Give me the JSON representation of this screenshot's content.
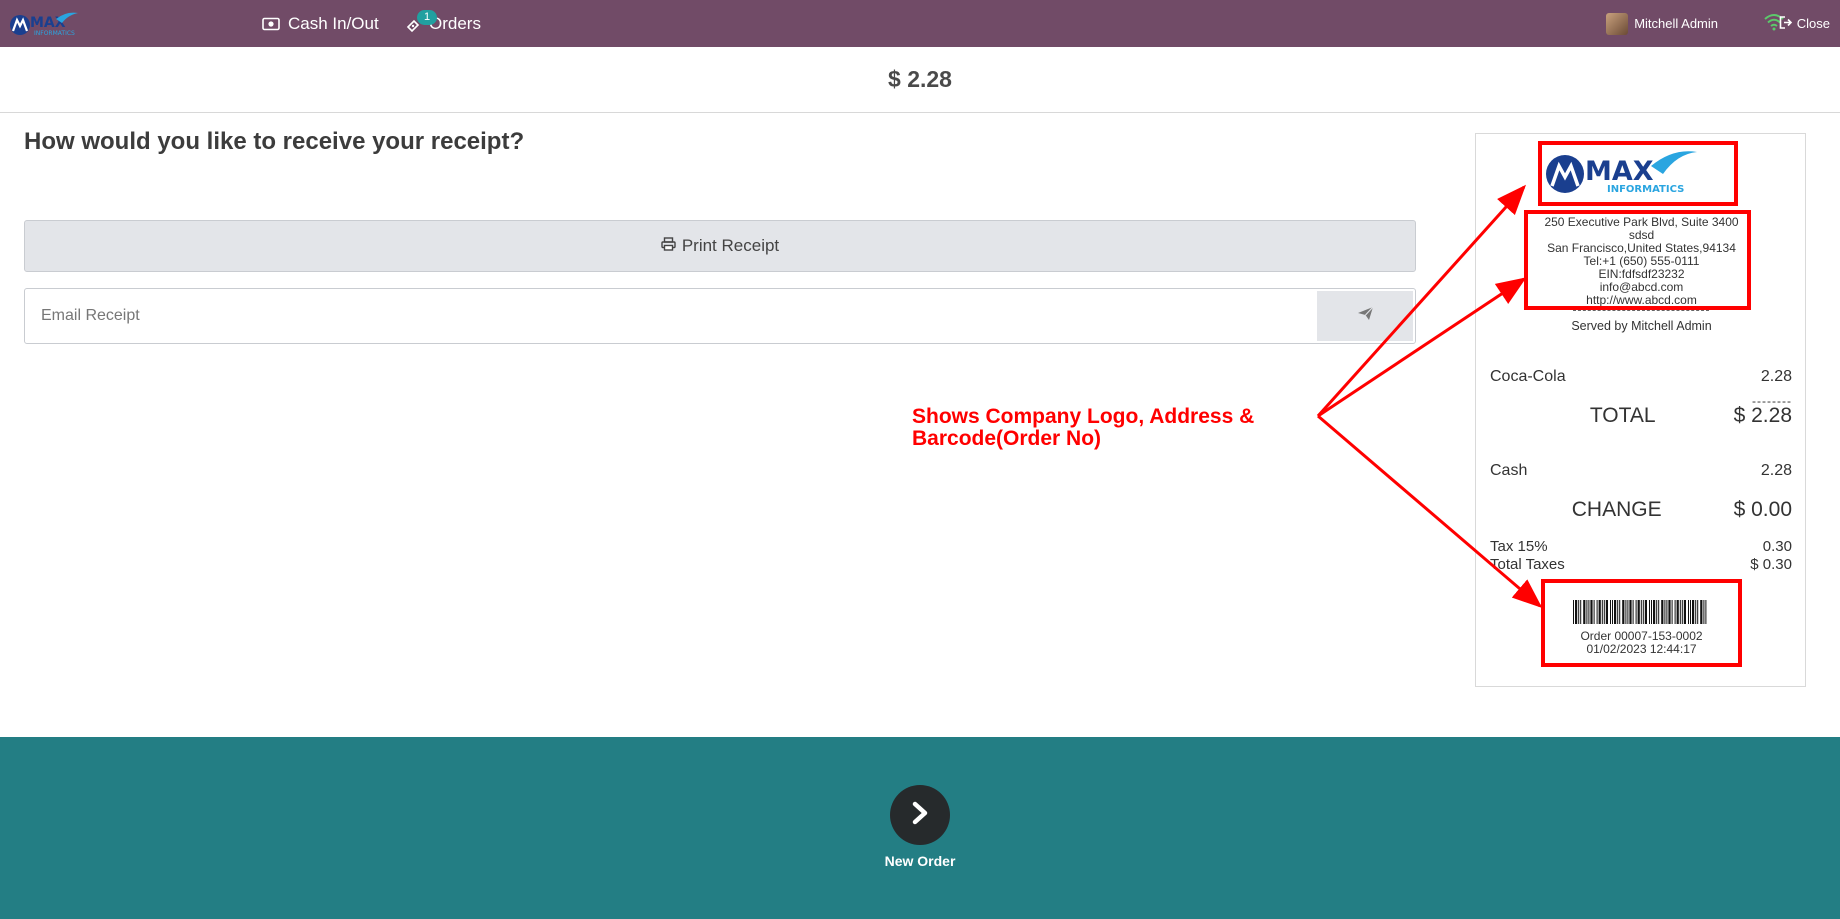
{
  "navbar": {
    "brand": "MAX INFORMATICS",
    "cash_label": "Cash In/Out",
    "orders_label": "Orders",
    "orders_badge": "1",
    "user_name": "Mitchell Admin",
    "close_label": "Close"
  },
  "amount": "$ 2.28",
  "receipt_prompt": {
    "question": "How would you like to receive your receipt?",
    "print_label": "Print Receipt",
    "email_placeholder": "Email Receipt"
  },
  "annotation": "Shows Company Logo, Address & Barcode(Order No)",
  "receipt": {
    "logo_text_main": "MAX",
    "logo_text_sub": "INFORMATICS",
    "address_lines": [
      "250 Executive Park Blvd, Suite 3400",
      "sdsd",
      "San Francisco,United States,94134",
      "Tel:+1 (650) 555-0111",
      "EIN:fdfsdf23232",
      "info@abcd.com",
      "http://www.abcd.com"
    ],
    "served_by": "Served by Mitchell Admin",
    "item_name": "Coca-Cola",
    "item_price": "2.28",
    "dash_line": "--------",
    "total_label": "TOTAL",
    "total_value": "$ 2.28",
    "cash_label": "Cash",
    "cash_value": "2.28",
    "change_label": "CHANGE",
    "change_value": "$ 0.00",
    "tax_label": "Tax 15%",
    "tax_value": "0.30",
    "total_taxes_label": "Total Taxes",
    "total_taxes_value": "$ 0.30",
    "order_no": "Order 00007-153-0002",
    "order_date": "01/02/2023 12:44:17"
  },
  "footer": {
    "new_order_label": "New Order"
  },
  "colors": {
    "navbar": "#714b67",
    "footer": "#237e84",
    "annotation": "#ff0000",
    "badge": "#21a0a0"
  }
}
